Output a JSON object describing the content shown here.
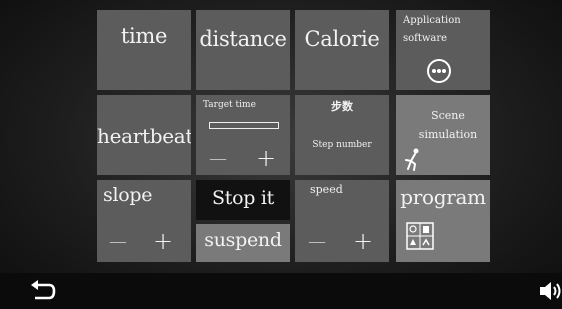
{
  "tiles": {
    "time": "time",
    "distance": "distance",
    "calorie": "Calorie",
    "app_software": "Application software",
    "heartbeat": "heartbeat",
    "target_time": "Target time",
    "step_cn": "步数",
    "step_number": "Step number",
    "scene_simulation": "Scene simulation",
    "slope": "slope",
    "stop_it": "Stop it",
    "suspend": "suspend",
    "speed": "speed",
    "program": "program"
  },
  "controls": {
    "minus": "—",
    "plus": "+"
  },
  "icons": {
    "app_grid": "app-grid-icon",
    "walker": "walker-icon",
    "program": "program-grid-icon",
    "back": "back-icon",
    "volume": "volume-icon"
  }
}
